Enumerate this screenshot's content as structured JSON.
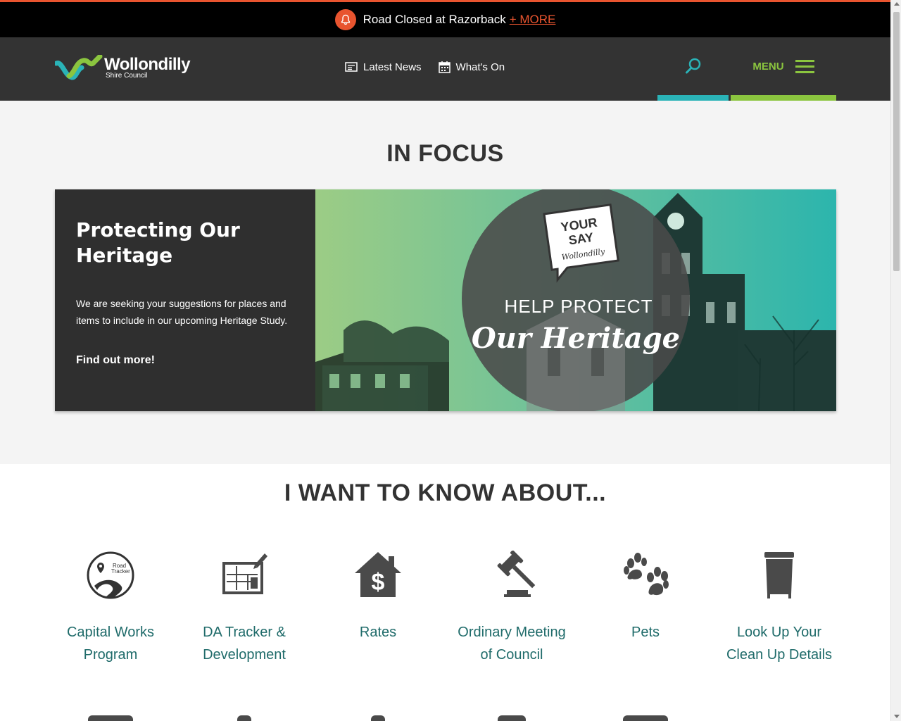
{
  "alert": {
    "text": "Road Closed at Razorback",
    "more_label": "+ MORE"
  },
  "header": {
    "logo_name": "Wollondilly",
    "logo_sub": "Shire Council",
    "nav": [
      {
        "label": "Latest News",
        "icon": "newspaper-icon"
      },
      {
        "label": "What's On",
        "icon": "calendar-icon"
      }
    ],
    "menu_label": "MENU"
  },
  "focus": {
    "title": "IN FOCUS",
    "heading": "Protecting Our Heritage",
    "description": "We are seeking your suggestions for places and items to include in our upcoming Heritage Study.",
    "link": "Find out more!",
    "image": {
      "badge_line1": "YOUR",
      "badge_line2": "SAY",
      "badge_line3": "Wollondilly",
      "caption1": "HELP PROTECT",
      "caption2": "Our Heritage"
    }
  },
  "know": {
    "title": "I WANT TO KNOW ABOUT...",
    "tiles": [
      {
        "label": "Capital Works Program",
        "icon": "road-tracker-icon",
        "icon_text1": "Road",
        "icon_text2": "Tracker"
      },
      {
        "label": "DA Tracker & Development",
        "icon": "blueprint-icon"
      },
      {
        "label": "Rates",
        "icon": "house-dollar-icon"
      },
      {
        "label": "Ordinary Meeting of Council",
        "icon": "gavel-icon"
      },
      {
        "label": "Pets",
        "icon": "paw-icon"
      },
      {
        "label": "Look Up Your Clean Up Details",
        "icon": "bin-icon"
      }
    ]
  },
  "colors": {
    "alert_accent": "#e8542f",
    "teal": "#2ab3b7",
    "green": "#8bc53f",
    "link_text": "#1f6b6a",
    "header_bg": "#333333"
  }
}
